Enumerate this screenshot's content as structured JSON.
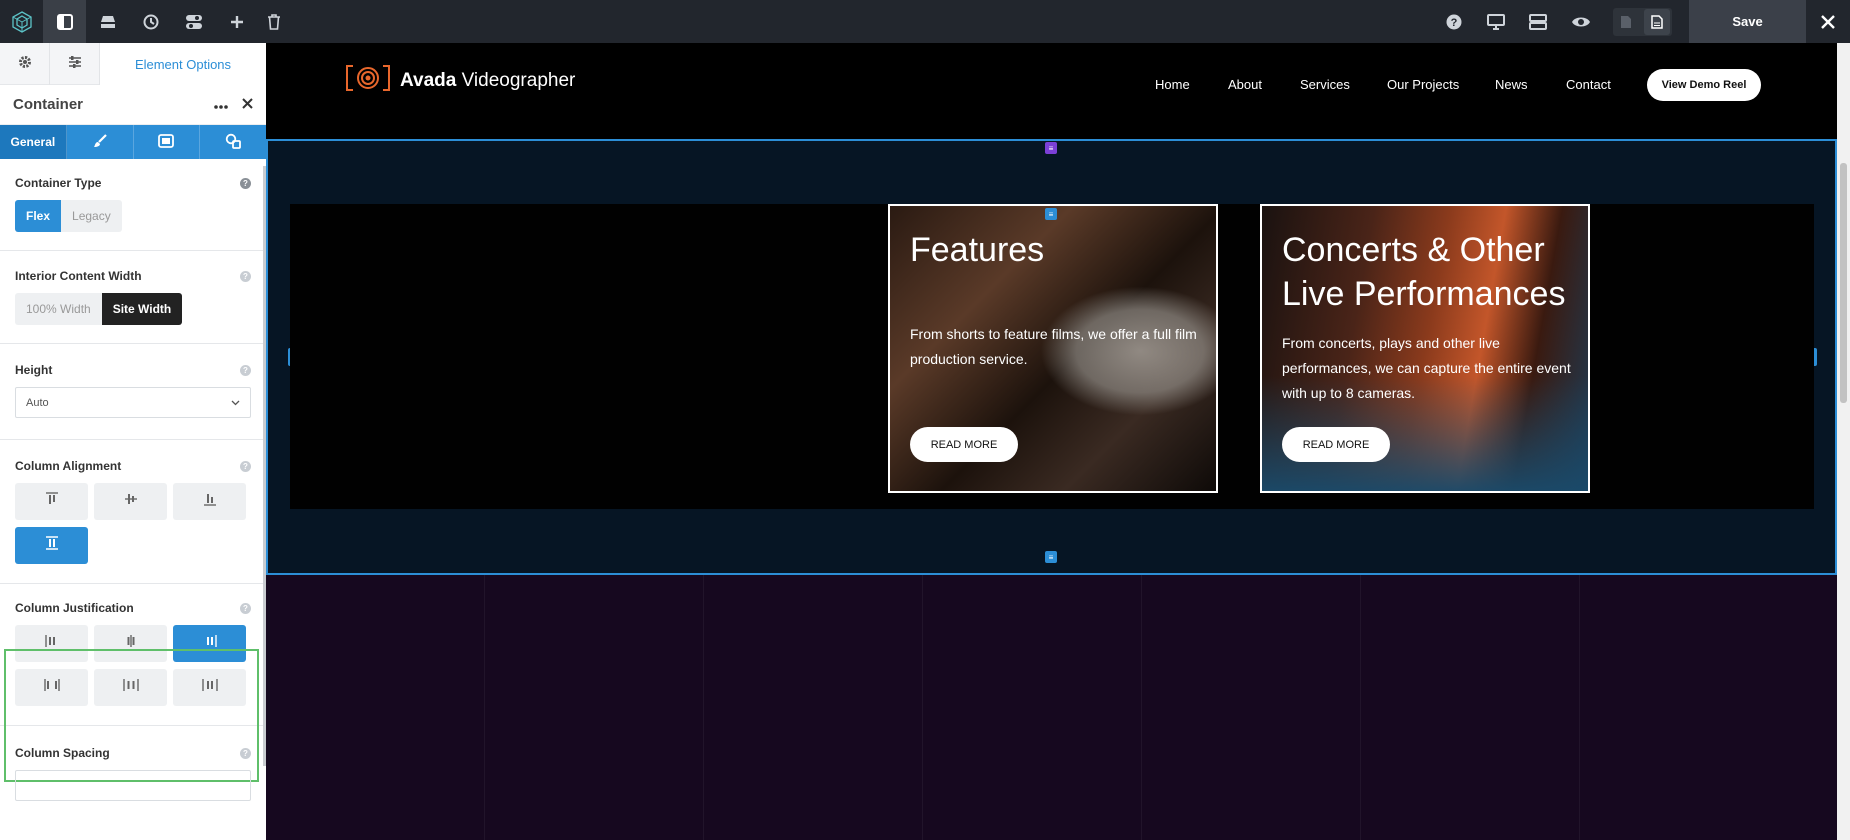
{
  "toolbar": {
    "save_label": "Save"
  },
  "panel": {
    "tab_main": "Element Options",
    "element_title": "Container",
    "subtabs": [
      "General"
    ],
    "container_type": {
      "label": "Container Type",
      "options": [
        "Flex",
        "Legacy"
      ],
      "selected": "Flex"
    },
    "interior_width": {
      "label": "Interior Content Width",
      "options": [
        "100% Width",
        "Site Width"
      ],
      "selected": "Site Width"
    },
    "height": {
      "label": "Height",
      "value": "Auto"
    },
    "column_alignment": {
      "label": "Column Alignment",
      "selected_index": 3
    },
    "column_justification": {
      "label": "Column Justification",
      "selected_index": 2
    },
    "column_spacing": {
      "label": "Column Spacing",
      "value": ""
    }
  },
  "site": {
    "brand_bold": "Avada",
    "brand_rest": " Videographer",
    "nav": [
      "Home",
      "About",
      "Services",
      "Our Projects",
      "News",
      "Contact"
    ],
    "cta": "View Demo Reel"
  },
  "cards": [
    {
      "title": "Features",
      "text": "From shorts to feature films, we offer a full film production service.",
      "button": "READ MORE"
    },
    {
      "title": "Concerts & Other Live Performances",
      "text": "From concerts, plays and other live performances, we can capture the entire event with up to 8 cameras.",
      "button": "READ MORE"
    }
  ],
  "colors": {
    "accent": "#2c8ed6",
    "logo": "#e8672c",
    "highlight": "#5fbf6a",
    "canvas_bg": "#16081f"
  }
}
